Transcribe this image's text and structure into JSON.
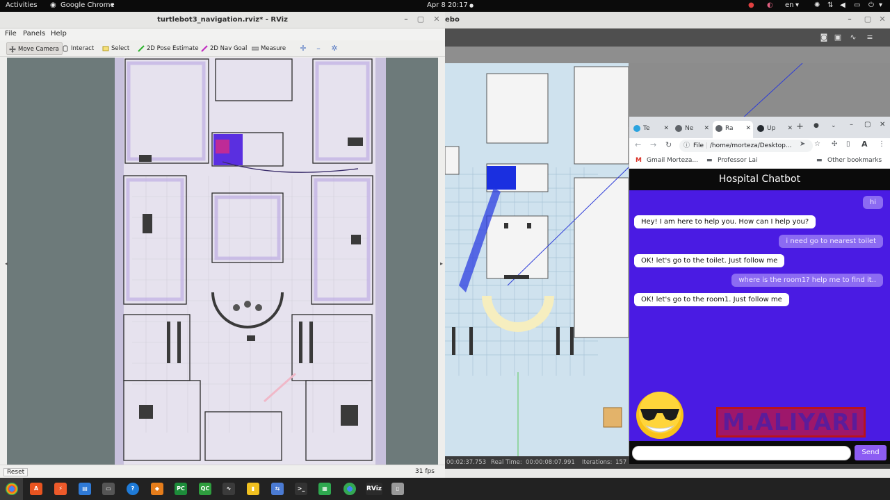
{
  "topbar": {
    "activities": "Activities",
    "app": "Google Chrome",
    "clock": "Apr 8  20:17",
    "lang": "en"
  },
  "rviz": {
    "title": "turtlebot3_navigation.rviz* - RViz",
    "menu": [
      "File",
      "Panels",
      "Help"
    ],
    "tools": [
      "Move Camera",
      "Interact",
      "Select",
      "2D Pose Estimate",
      "2D Nav Goal",
      "Measure"
    ],
    "reset_label": "Reset",
    "fps": "31 fps"
  },
  "gazebo": {
    "title_fragment": "ebo",
    "status": {
      "sim_time_fragment": "00:02:37.753",
      "real_time_label": "Real Time:",
      "real_time": "00:00:08:07.991",
      "iterations_label": "Iterations:",
      "iterations_fragment": "157"
    }
  },
  "chrome": {
    "tabs": [
      {
        "label": "Te",
        "color": "#2aa3df"
      },
      {
        "label": "Ne",
        "color": "#5f6368"
      },
      {
        "label": "Ra",
        "color": "#5f6368"
      },
      {
        "label": "Up",
        "color": "#24292f"
      }
    ],
    "url": "/home/morteza/Desktop...",
    "url_prefix": "File",
    "bookmarks": [
      "Gmail Morteza...",
      "Professor Lai",
      "Other bookmarks"
    ]
  },
  "chat": {
    "title": "Hospital Chatbot",
    "messages": [
      {
        "from": "user",
        "text": "hi"
      },
      {
        "from": "bot",
        "text": "Hey! I am here to help you. How can I help you?"
      },
      {
        "from": "user",
        "text": "i need go to nearest toilet"
      },
      {
        "from": "bot",
        "text": "OK! let's go to the toilet. Just follow me"
      },
      {
        "from": "user",
        "text": "where is the room1? help me to find it.."
      },
      {
        "from": "bot",
        "text": "OK! let's go to the room1. Just follow me"
      }
    ],
    "watermark": "M.ALIYARI",
    "input_placeholder": "",
    "send_label": "Send"
  },
  "taskbar": {
    "rviz_label": "RViz"
  },
  "colors": {
    "chat_bg": "#4a1be3",
    "user_bubble": "#8c6bf2",
    "send": "#8c5cf3",
    "watermark": "#d7161b"
  }
}
